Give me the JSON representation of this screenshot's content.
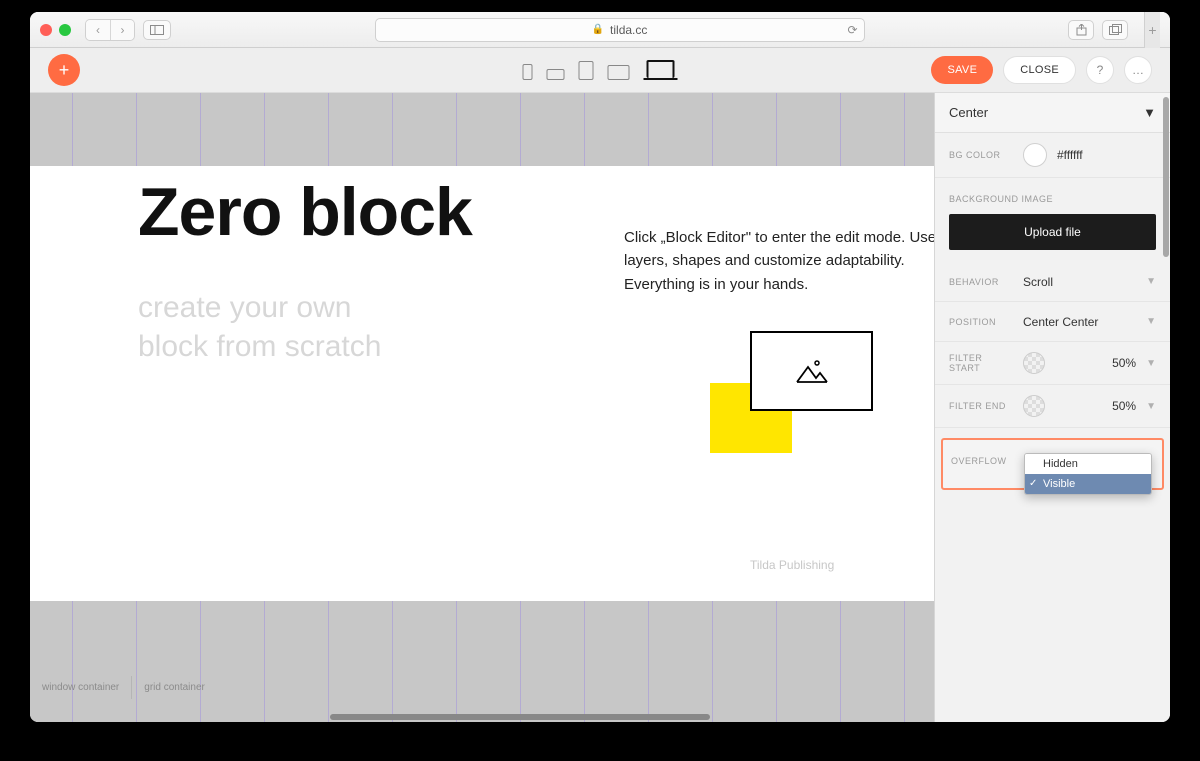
{
  "browser": {
    "url": "tilda.cc"
  },
  "toolbar": {
    "save": "SAVE",
    "close": "CLOSE"
  },
  "canvas": {
    "headline": "Zero block",
    "subtitle_l1": "create your own",
    "subtitle_l2": "block from scratch",
    "description": "Click „Block Editor\" to enter the edit mode. Use layers, shapes and customize adaptability. Everything is in your hands.",
    "credit": "Tilda Publishing",
    "footer_window": "window container",
    "footer_grid": "grid container"
  },
  "panel": {
    "align": "Center",
    "bg_color_label": "BG COLOR",
    "bg_color_value": "#ffffff",
    "bg_image_h": "BACKGROUND IMAGE",
    "upload": "Upload file",
    "behavior_label": "BEHAVIOR",
    "behavior_value": "Scroll",
    "position_label": "POSITION",
    "position_value": "Center Center",
    "filter_start_label": "FILTER START",
    "filter_start_value": "50%",
    "filter_end_label": "FILTER END",
    "filter_end_value": "50%",
    "overflow_label": "OVERFLOW",
    "overflow_opts": {
      "hidden": "Hidden",
      "visible": "Visible"
    }
  }
}
